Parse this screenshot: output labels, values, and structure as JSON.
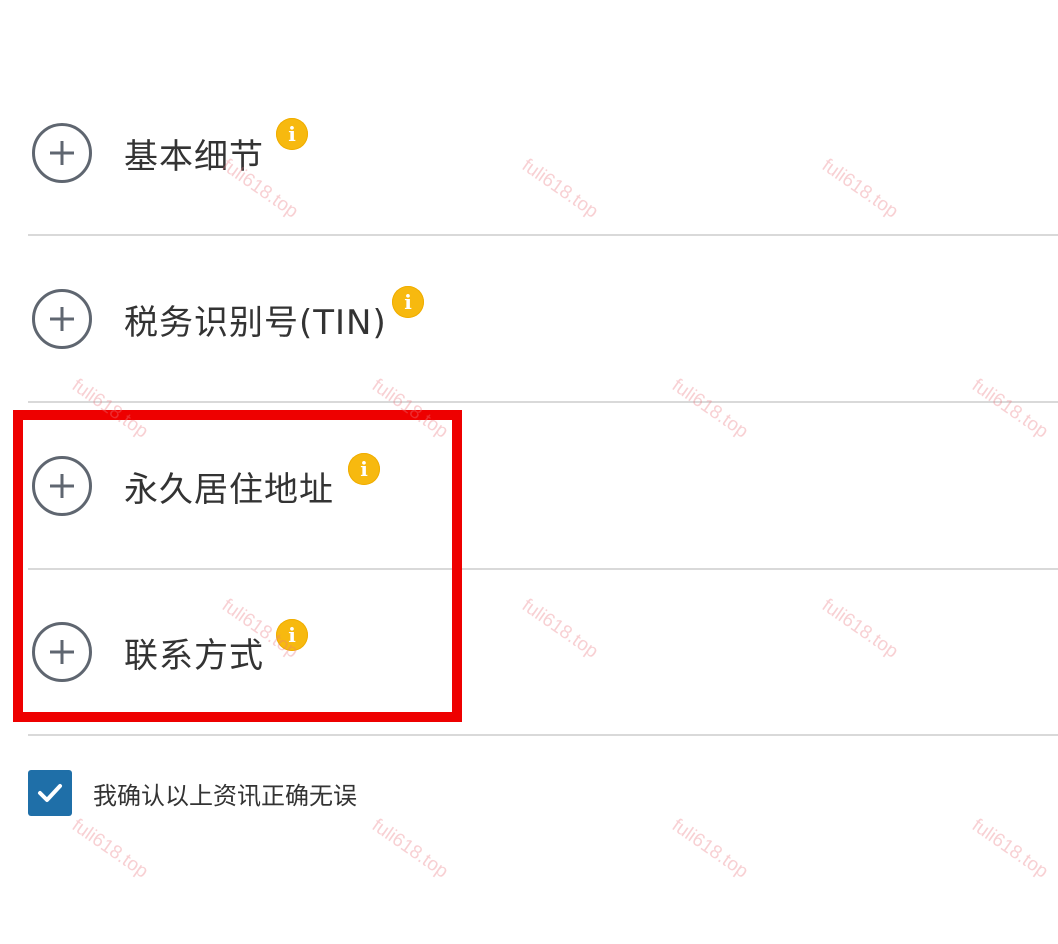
{
  "sections": [
    {
      "title": "基本细节",
      "info_icon": "info-icon"
    },
    {
      "title": "税务识别号(TIN)",
      "info_icon": "info-icon"
    },
    {
      "title": "永久居住地址",
      "info_icon": "info-icon"
    },
    {
      "title": "联系方式",
      "info_icon": "info-icon"
    }
  ],
  "confirm": {
    "label": "我确认以上资讯正确无误",
    "checked": true
  },
  "watermark": {
    "text": "fuli618.top"
  },
  "colors": {
    "highlight": "#ee0000",
    "checkbox": "#1f6fa8",
    "info": "#f7b90f",
    "icon_stroke": "#5f6670",
    "divider": "#d9d9d9"
  }
}
